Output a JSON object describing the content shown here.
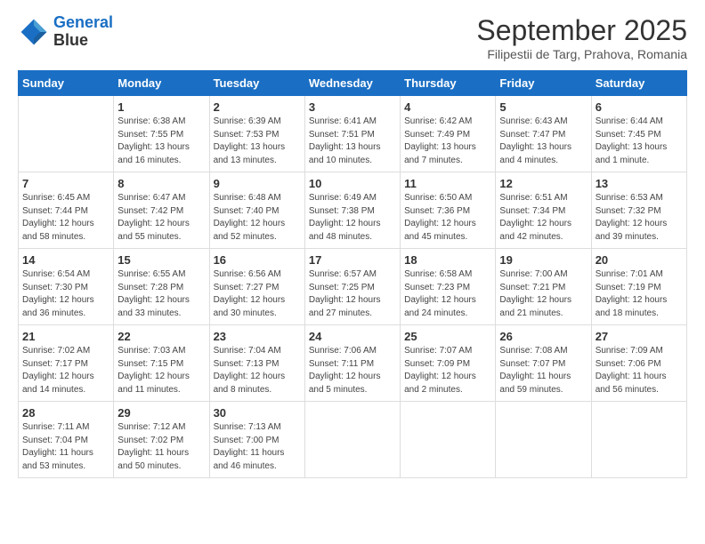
{
  "header": {
    "logo_line1": "General",
    "logo_line2": "Blue",
    "title": "September 2025",
    "subtitle": "Filipestii de Targ, Prahova, Romania"
  },
  "days_of_week": [
    "Sunday",
    "Monday",
    "Tuesday",
    "Wednesday",
    "Thursday",
    "Friday",
    "Saturday"
  ],
  "weeks": [
    [
      {
        "day": "",
        "sunrise": "",
        "sunset": "",
        "daylight": ""
      },
      {
        "day": "1",
        "sunrise": "Sunrise: 6:38 AM",
        "sunset": "Sunset: 7:55 PM",
        "daylight": "Daylight: 13 hours and 16 minutes."
      },
      {
        "day": "2",
        "sunrise": "Sunrise: 6:39 AM",
        "sunset": "Sunset: 7:53 PM",
        "daylight": "Daylight: 13 hours and 13 minutes."
      },
      {
        "day": "3",
        "sunrise": "Sunrise: 6:41 AM",
        "sunset": "Sunset: 7:51 PM",
        "daylight": "Daylight: 13 hours and 10 minutes."
      },
      {
        "day": "4",
        "sunrise": "Sunrise: 6:42 AM",
        "sunset": "Sunset: 7:49 PM",
        "daylight": "Daylight: 13 hours and 7 minutes."
      },
      {
        "day": "5",
        "sunrise": "Sunrise: 6:43 AM",
        "sunset": "Sunset: 7:47 PM",
        "daylight": "Daylight: 13 hours and 4 minutes."
      },
      {
        "day": "6",
        "sunrise": "Sunrise: 6:44 AM",
        "sunset": "Sunset: 7:45 PM",
        "daylight": "Daylight: 13 hours and 1 minute."
      }
    ],
    [
      {
        "day": "7",
        "sunrise": "Sunrise: 6:45 AM",
        "sunset": "Sunset: 7:44 PM",
        "daylight": "Daylight: 12 hours and 58 minutes."
      },
      {
        "day": "8",
        "sunrise": "Sunrise: 6:47 AM",
        "sunset": "Sunset: 7:42 PM",
        "daylight": "Daylight: 12 hours and 55 minutes."
      },
      {
        "day": "9",
        "sunrise": "Sunrise: 6:48 AM",
        "sunset": "Sunset: 7:40 PM",
        "daylight": "Daylight: 12 hours and 52 minutes."
      },
      {
        "day": "10",
        "sunrise": "Sunrise: 6:49 AM",
        "sunset": "Sunset: 7:38 PM",
        "daylight": "Daylight: 12 hours and 48 minutes."
      },
      {
        "day": "11",
        "sunrise": "Sunrise: 6:50 AM",
        "sunset": "Sunset: 7:36 PM",
        "daylight": "Daylight: 12 hours and 45 minutes."
      },
      {
        "day": "12",
        "sunrise": "Sunrise: 6:51 AM",
        "sunset": "Sunset: 7:34 PM",
        "daylight": "Daylight: 12 hours and 42 minutes."
      },
      {
        "day": "13",
        "sunrise": "Sunrise: 6:53 AM",
        "sunset": "Sunset: 7:32 PM",
        "daylight": "Daylight: 12 hours and 39 minutes."
      }
    ],
    [
      {
        "day": "14",
        "sunrise": "Sunrise: 6:54 AM",
        "sunset": "Sunset: 7:30 PM",
        "daylight": "Daylight: 12 hours and 36 minutes."
      },
      {
        "day": "15",
        "sunrise": "Sunrise: 6:55 AM",
        "sunset": "Sunset: 7:28 PM",
        "daylight": "Daylight: 12 hours and 33 minutes."
      },
      {
        "day": "16",
        "sunrise": "Sunrise: 6:56 AM",
        "sunset": "Sunset: 7:27 PM",
        "daylight": "Daylight: 12 hours and 30 minutes."
      },
      {
        "day": "17",
        "sunrise": "Sunrise: 6:57 AM",
        "sunset": "Sunset: 7:25 PM",
        "daylight": "Daylight: 12 hours and 27 minutes."
      },
      {
        "day": "18",
        "sunrise": "Sunrise: 6:58 AM",
        "sunset": "Sunset: 7:23 PM",
        "daylight": "Daylight: 12 hours and 24 minutes."
      },
      {
        "day": "19",
        "sunrise": "Sunrise: 7:00 AM",
        "sunset": "Sunset: 7:21 PM",
        "daylight": "Daylight: 12 hours and 21 minutes."
      },
      {
        "day": "20",
        "sunrise": "Sunrise: 7:01 AM",
        "sunset": "Sunset: 7:19 PM",
        "daylight": "Daylight: 12 hours and 18 minutes."
      }
    ],
    [
      {
        "day": "21",
        "sunrise": "Sunrise: 7:02 AM",
        "sunset": "Sunset: 7:17 PM",
        "daylight": "Daylight: 12 hours and 14 minutes."
      },
      {
        "day": "22",
        "sunrise": "Sunrise: 7:03 AM",
        "sunset": "Sunset: 7:15 PM",
        "daylight": "Daylight: 12 hours and 11 minutes."
      },
      {
        "day": "23",
        "sunrise": "Sunrise: 7:04 AM",
        "sunset": "Sunset: 7:13 PM",
        "daylight": "Daylight: 12 hours and 8 minutes."
      },
      {
        "day": "24",
        "sunrise": "Sunrise: 7:06 AM",
        "sunset": "Sunset: 7:11 PM",
        "daylight": "Daylight: 12 hours and 5 minutes."
      },
      {
        "day": "25",
        "sunrise": "Sunrise: 7:07 AM",
        "sunset": "Sunset: 7:09 PM",
        "daylight": "Daylight: 12 hours and 2 minutes."
      },
      {
        "day": "26",
        "sunrise": "Sunrise: 7:08 AM",
        "sunset": "Sunset: 7:07 PM",
        "daylight": "Daylight: 11 hours and 59 minutes."
      },
      {
        "day": "27",
        "sunrise": "Sunrise: 7:09 AM",
        "sunset": "Sunset: 7:06 PM",
        "daylight": "Daylight: 11 hours and 56 minutes."
      }
    ],
    [
      {
        "day": "28",
        "sunrise": "Sunrise: 7:11 AM",
        "sunset": "Sunset: 7:04 PM",
        "daylight": "Daylight: 11 hours and 53 minutes."
      },
      {
        "day": "29",
        "sunrise": "Sunrise: 7:12 AM",
        "sunset": "Sunset: 7:02 PM",
        "daylight": "Daylight: 11 hours and 50 minutes."
      },
      {
        "day": "30",
        "sunrise": "Sunrise: 7:13 AM",
        "sunset": "Sunset: 7:00 PM",
        "daylight": "Daylight: 11 hours and 46 minutes."
      },
      {
        "day": "",
        "sunrise": "",
        "sunset": "",
        "daylight": ""
      },
      {
        "day": "",
        "sunrise": "",
        "sunset": "",
        "daylight": ""
      },
      {
        "day": "",
        "sunrise": "",
        "sunset": "",
        "daylight": ""
      },
      {
        "day": "",
        "sunrise": "",
        "sunset": "",
        "daylight": ""
      }
    ]
  ]
}
